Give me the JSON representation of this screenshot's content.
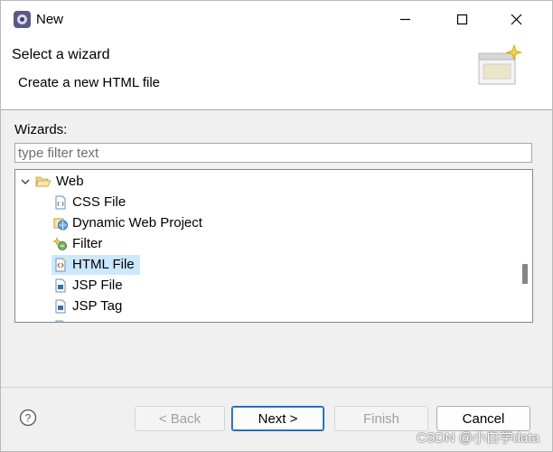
{
  "window": {
    "title": "New"
  },
  "header": {
    "title": "Select a wizard",
    "description": "Create a new HTML file"
  },
  "wizards": {
    "label": "Wizards:",
    "filter_placeholder": "type filter text",
    "filter_value": "",
    "tree": {
      "root": {
        "label": "Web",
        "expanded": true,
        "icon": "open-folder-icon"
      },
      "children": [
        {
          "label": "CSS File",
          "icon": "css-file-icon",
          "selected": false
        },
        {
          "label": "Dynamic Web Project",
          "icon": "web-project-icon",
          "selected": false
        },
        {
          "label": "Filter",
          "icon": "filter-icon",
          "selected": false
        },
        {
          "label": "HTML File",
          "icon": "html-file-icon",
          "selected": true
        },
        {
          "label": "JSP File",
          "icon": "jsp-file-icon",
          "selected": false
        },
        {
          "label": "JSP Tag",
          "icon": "jsp-tag-icon",
          "selected": false
        }
      ]
    }
  },
  "buttons": {
    "back": "< Back",
    "next": "Next >",
    "finish": "Finish",
    "cancel": "Cancel"
  },
  "watermark": "CSDN @小白学data",
  "colors": {
    "selection": "#cce8ff",
    "default_button_border": "#1a5fb4"
  }
}
